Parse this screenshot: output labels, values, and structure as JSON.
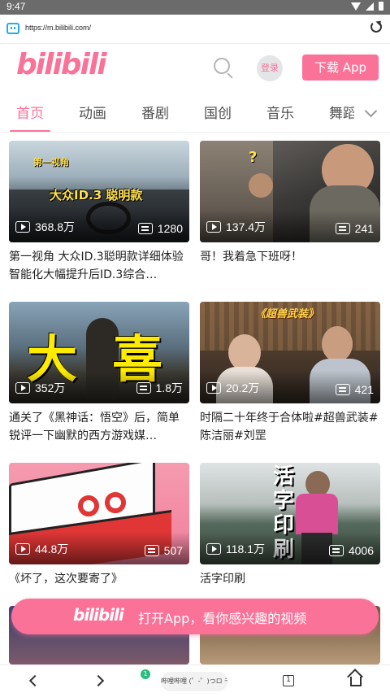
{
  "status_bar": {
    "time": "9:47"
  },
  "browser": {
    "url": "https://m.bilibili.com/",
    "tab_count": "1",
    "notification_count": "1",
    "tab_chip_text": "哔哩哔哩 (゜-゜)つロ 干"
  },
  "header": {
    "logo_text": "bilibili",
    "login_label": "登录",
    "download_label": "下载 App"
  },
  "tabs": [
    {
      "label": "首页",
      "active": true
    },
    {
      "label": "动画"
    },
    {
      "label": "番剧"
    },
    {
      "label": "国创"
    },
    {
      "label": "音乐"
    },
    {
      "label": "舞蹈"
    }
  ],
  "videos": [
    {
      "title": "第一视角 大众ID.3聪明款详细体验 智能化大幅提升后ID.3综合…",
      "views": "368.8万",
      "danmaku": "1280",
      "thumb_text": "大众ID.3 聪明款",
      "thumb_subtext": "第一视角"
    },
    {
      "title": "哥！我着急下班呀！",
      "views": "137.4万",
      "danmaku": "241",
      "thumb_text": "?"
    },
    {
      "title": "通关了《黑神话：悟空》后，简单锐评一下幽默的西方游戏媒…",
      "views": "352万",
      "danmaku": "1.8万",
      "thumb_text": "大  喜"
    },
    {
      "title": "时隔二十年终于合体啦#超兽武装#陈洁丽#刘罡",
      "views": "20.2万",
      "danmaku": "421",
      "thumb_text": "《超兽武装》"
    },
    {
      "title": "《坏了，这次要寄了》",
      "views": "44.8万",
      "danmaku": "507"
    },
    {
      "title": "活字印刷",
      "views": "118.1万",
      "danmaku": "4006",
      "thumb_text": "活字印刷"
    }
  ],
  "banner": {
    "logo_text": "bilibili",
    "text": "打开App，看你感兴趣的视频"
  },
  "colors": {
    "brand_pink": "#fb7299",
    "text": "#212121",
    "status_bar": "#6b6b6b"
  }
}
